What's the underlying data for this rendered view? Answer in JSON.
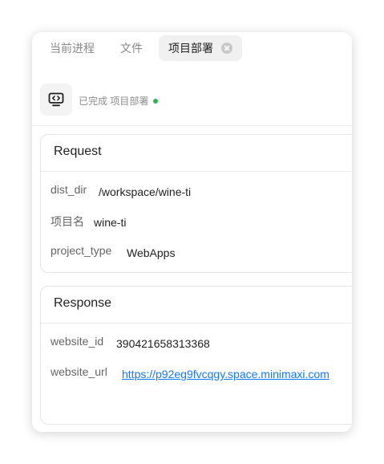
{
  "tabs": [
    {
      "label": "当前进程",
      "active": false
    },
    {
      "label": "文件",
      "active": false
    },
    {
      "label": "项目部署",
      "active": true
    }
  ],
  "status": {
    "icon": "code-screen-icon",
    "label": "已完成 项目部署",
    "dot_color": "#2fb34a"
  },
  "request": {
    "title": "Request",
    "fields": [
      {
        "key": "dist_dir",
        "value": "/workspace/wine-ti"
      },
      {
        "key": "项目名",
        "value": "wine-ti"
      },
      {
        "key": "project_type",
        "value": "WebApps"
      }
    ]
  },
  "response": {
    "title": "Response",
    "fields": [
      {
        "key": "website_id",
        "value": "390421658313368"
      },
      {
        "key": "website_url",
        "value": "https://p92eg9fvcqgy.space.minimaxi.com"
      }
    ]
  },
  "colors": {
    "link": "#1677ff",
    "success": "#2fb34a"
  }
}
